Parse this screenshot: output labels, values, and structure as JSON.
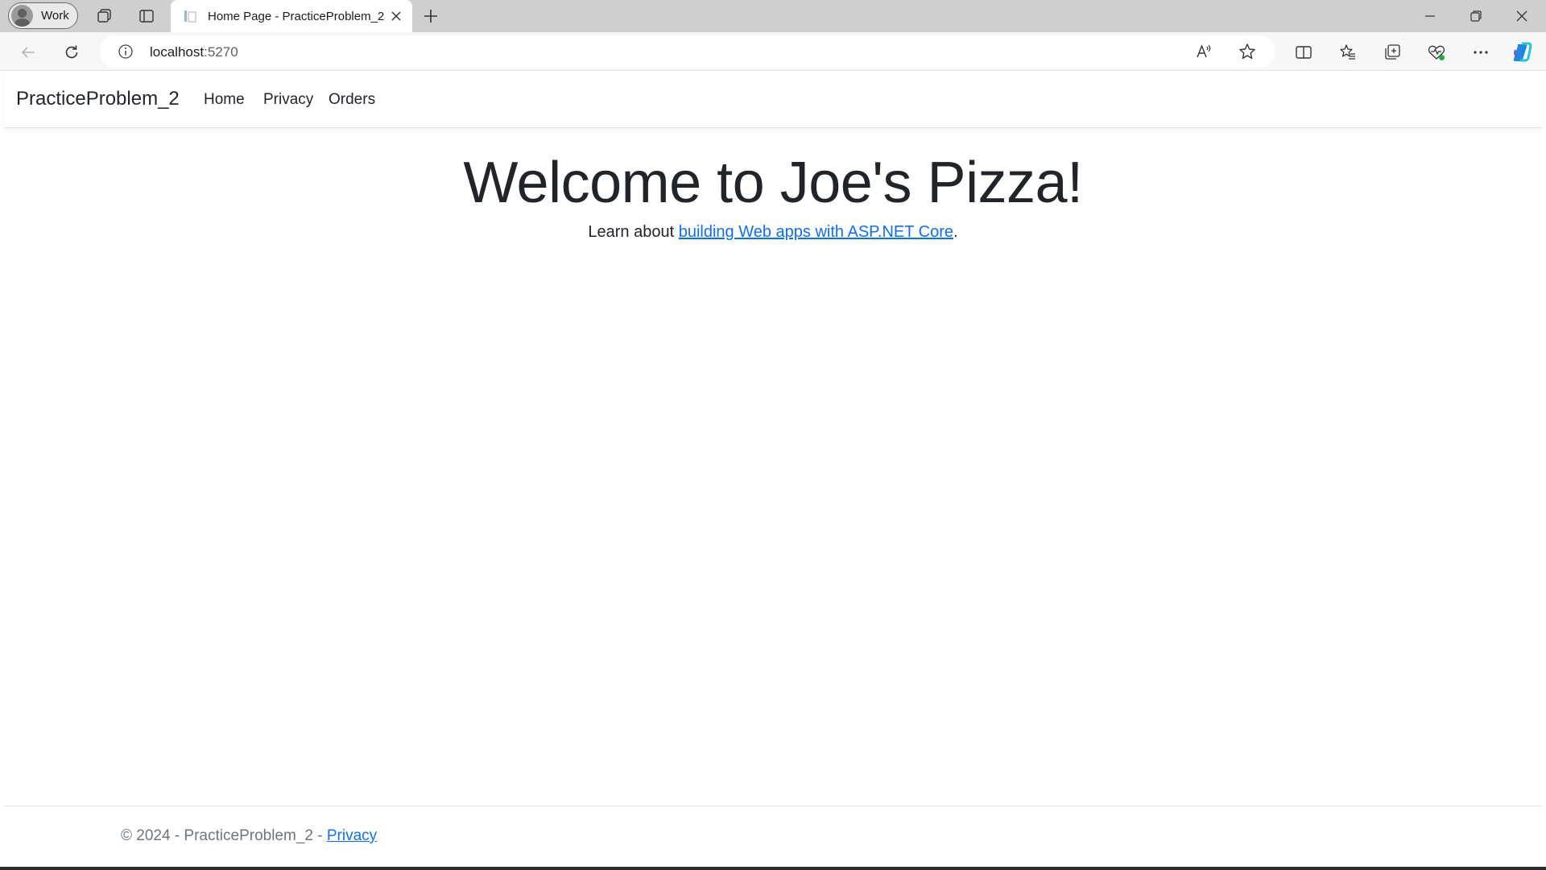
{
  "browser": {
    "profile_label": "Work",
    "tab_title": "Home Page - PracticeProblem_2",
    "address": {
      "host": "localhost",
      "port": ":5270"
    }
  },
  "site": {
    "brand": "PracticeProblem_2",
    "nav": [
      {
        "label": "Home"
      },
      {
        "label": "Privacy"
      },
      {
        "label": "Orders"
      }
    ],
    "hero": {
      "title": "Welcome to Joe's Pizza!",
      "text_before": "Learn about ",
      "link_text": "building Web apps with ASP.NET Core",
      "text_after": "."
    },
    "footer": {
      "text": "© 2024 - PracticeProblem_2 - ",
      "link_text": "Privacy"
    }
  },
  "colors": {
    "link": "#0d6efd",
    "text": "#212529",
    "muted": "#6c757d",
    "tabstrip": "#cfcfcf"
  }
}
